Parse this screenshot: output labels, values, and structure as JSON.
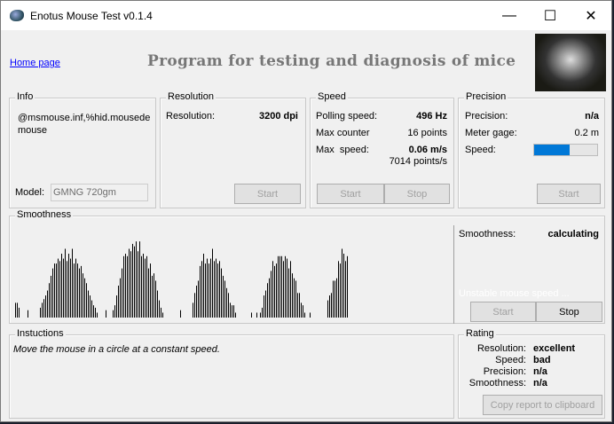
{
  "window": {
    "title": "Enotus Mouse Test v0.1.4",
    "minimize": "—",
    "maximize": "☐",
    "close": "✕"
  },
  "header": {
    "home_link": "Home page",
    "heading": "Program for testing and diagnosis of mice"
  },
  "info": {
    "label": "Info",
    "device": "@msmouse.inf,%hid.mousede mouse",
    "model_label": "Model:",
    "model_value": "GMNG 720gm"
  },
  "resolution": {
    "label": "Resolution",
    "key": "Resolution:",
    "value": "3200 dpi",
    "start": "Start"
  },
  "speed": {
    "label": "Speed",
    "polling_key": "Polling speed:",
    "polling_value": "496 Hz",
    "counter_key": "Max counter",
    "counter_value": "16 points",
    "max_key": "Max  speed:",
    "max_value": "0.06 m/s",
    "max_points": "7014 points/s",
    "start": "Start",
    "stop": "Stop"
  },
  "precision": {
    "label": "Precision",
    "precision_key": "Precision:",
    "precision_value": "n/a",
    "gage_key": "Meter gage:",
    "gage_value": "0.2 m",
    "speed_key": "Speed:",
    "speed_fraction": 0.56,
    "start": "Start"
  },
  "smoothness": {
    "label": "Smoothness",
    "key": "Smoothness:",
    "value": "calculating",
    "status": "Unstable mouse speed ...",
    "start": "Start",
    "stop": "Stop"
  },
  "chart_data": {
    "type": "bar",
    "title": "Smoothness",
    "ylim": [
      0,
      70
    ],
    "values": [
      12,
      12,
      8,
      0,
      0,
      0,
      0,
      6,
      0,
      0,
      0,
      0,
      0,
      0,
      8,
      12,
      15,
      18,
      22,
      28,
      34,
      40,
      44,
      44,
      48,
      46,
      52,
      48,
      56,
      46,
      52,
      48,
      56,
      44,
      48,
      44,
      40,
      42,
      36,
      32,
      28,
      22,
      18,
      14,
      10,
      8,
      4,
      0,
      0,
      0,
      0,
      6,
      0,
      0,
      0,
      6,
      10,
      18,
      26,
      32,
      40,
      50,
      52,
      50,
      56,
      54,
      60,
      58,
      62,
      54,
      62,
      50,
      52,
      48,
      50,
      40,
      44,
      34,
      36,
      30,
      22,
      14,
      8,
      4,
      0,
      0,
      0,
      0,
      0,
      0,
      0,
      0,
      0,
      6,
      0,
      0,
      0,
      0,
      0,
      0,
      12,
      20,
      26,
      30,
      42,
      46,
      52,
      44,
      48,
      44,
      48,
      56,
      46,
      48,
      44,
      46,
      40,
      34,
      30,
      24,
      20,
      12,
      10,
      10,
      4,
      0,
      0,
      0,
      0,
      0,
      0,
      0,
      0,
      4,
      0,
      0,
      4,
      0,
      4,
      8,
      18,
      22,
      28,
      32,
      38,
      46,
      42,
      44,
      50,
      50,
      50,
      46,
      50,
      48,
      40,
      46,
      36,
      32,
      30,
      20,
      20,
      12,
      10,
      4,
      0,
      0,
      4,
      0,
      0,
      0,
      0,
      0,
      0,
      0,
      0,
      0,
      14,
      18,
      20,
      30,
      30,
      32,
      46,
      44,
      56,
      52,
      46,
      50
    ]
  },
  "instructions": {
    "label": "Instuctions",
    "text": "Move the mouse in a circle at a constant speed."
  },
  "rating": {
    "label": "Rating",
    "rows": [
      {
        "key": "Resolution:",
        "value": "excellent"
      },
      {
        "key": "Speed:",
        "value": "bad"
      },
      {
        "key": "Precision:",
        "value": "n/a"
      },
      {
        "key": "Smoothness:",
        "value": "n/a"
      }
    ],
    "copy": "Copy report to clipboard"
  },
  "colors": {
    "accent": "#0078d7",
    "link": "#0000ff"
  }
}
